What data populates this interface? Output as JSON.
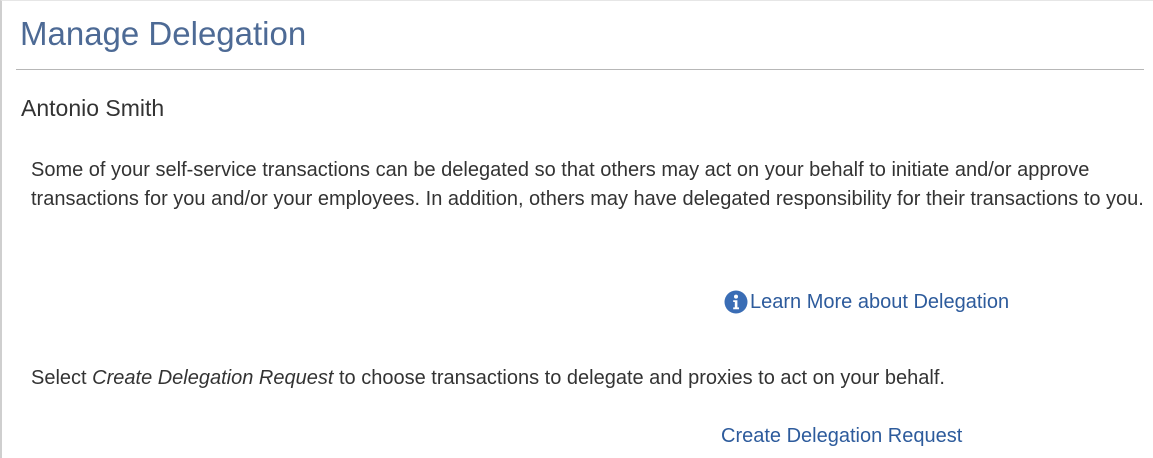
{
  "page": {
    "title": "Manage Delegation",
    "person_name": "Antonio Smith",
    "intro": "Some of your self-service transactions can be delegated so that others may act on your behalf to initiate and/or approve transactions for you and/or your employees. In addition, others may have delegated responsibility for their transactions to you.",
    "learn_more": {
      "label": "Learn More about Delegation",
      "icon": "info-circle-icon"
    },
    "instructions": {
      "prefix": "Select ",
      "emphasis": "Create Delegation Request",
      "suffix": " to choose transactions to delegate and proxies to act on your behalf."
    },
    "create_request_label": "Create Delegation Request"
  },
  "colors": {
    "title": "#4d6a95",
    "link": "#2d5b9c",
    "text": "#333333",
    "info_icon": "#3a6db5",
    "rule": "#b7b7b7"
  }
}
